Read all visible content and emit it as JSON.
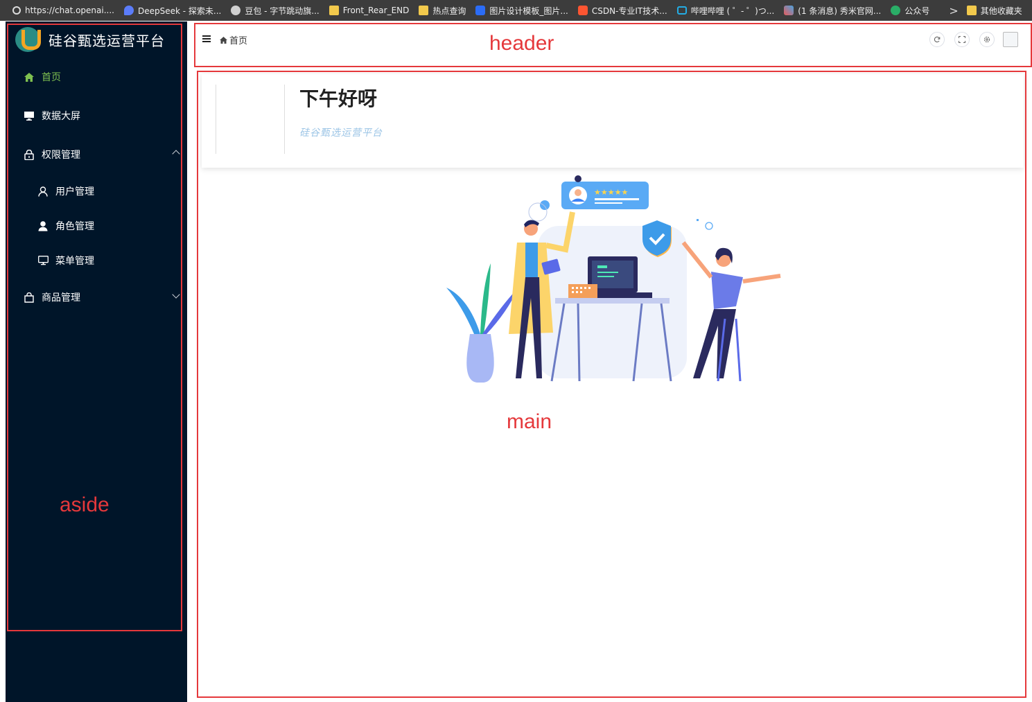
{
  "bookmarks": [
    {
      "label": "https://chat.openai....",
      "icon": "openai-icon",
      "color": "#ffffff"
    },
    {
      "label": "DeepSeek - 探索未...",
      "icon": "deepseek-icon",
      "color": "#5b7cfa"
    },
    {
      "label": "豆包 - 字节跳动旗...",
      "icon": "doubao-icon",
      "color": "#d0d0d0"
    },
    {
      "label": "Front_Rear_END",
      "icon": "folder-icon",
      "color": "#f2c94c"
    },
    {
      "label": "热点查询",
      "icon": "folder-icon",
      "color": "#f2c94c"
    },
    {
      "label": "图片设计模板_图片...",
      "icon": "design-icon",
      "color": "#2b6cf6"
    },
    {
      "label": "CSDN-专业IT技术...",
      "icon": "csdn-icon",
      "color": "#fc5531"
    },
    {
      "label": "哔哩哔哩 ( ゜- ゜)つ...",
      "icon": "bilibili-icon",
      "color": "#23ade5"
    },
    {
      "label": "(1 条消息) 秀米官网...",
      "icon": "xiumi-icon",
      "color": "#e85c5c"
    },
    {
      "label": "公众号",
      "icon": "wechat-icon",
      "color": "#2aae67"
    }
  ],
  "bookmarks_more": ">",
  "bookmarks_other": "其他收藏夹",
  "aside": {
    "title": "硅谷甄选运营平台",
    "annotation": "aside",
    "menu": [
      {
        "label": "首页",
        "icon": "home-icon",
        "active": true
      },
      {
        "label": "数据大屏",
        "icon": "monitor-icon"
      },
      {
        "label": "权限管理",
        "icon": "lock-icon",
        "expanded": true
      },
      {
        "label": "用户管理",
        "icon": "user-icon",
        "child": true
      },
      {
        "label": "角色管理",
        "icon": "user-filled-icon",
        "child": true
      },
      {
        "label": "菜单管理",
        "icon": "monitor-icon",
        "child": true
      },
      {
        "label": "商品管理",
        "icon": "goods-icon",
        "expanded": false
      }
    ],
    "active_color": "#7ec050",
    "background": "#001529"
  },
  "header": {
    "annotation": "header",
    "breadcrumb": "首页",
    "buttons": [
      "refresh-icon",
      "fullscreen-icon",
      "setting-icon"
    ]
  },
  "main": {
    "annotation": "main",
    "greeting": "下午好呀",
    "subtitle": "硅谷甄选运营平台"
  }
}
